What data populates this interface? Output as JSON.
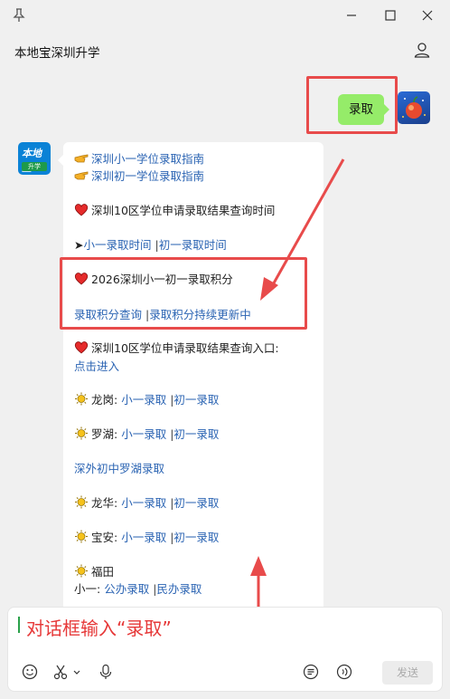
{
  "window": {
    "title": "本地宝深圳升学"
  },
  "outgoing": {
    "text": "录取"
  },
  "incoming": {
    "avatar": {
      "top": "本地宝",
      "bottom": "升学"
    },
    "links_top": [
      "深圳小一学位录取指南",
      "深圳初一学位录取指南"
    ],
    "heading_query_time": "深圳10区学位申请录取结果查询时间",
    "time_prefix": "➤",
    "time_links": [
      "小一录取时间",
      "初一录取时间"
    ],
    "heading_points": "2026深圳小一初一录取积分",
    "points_links": [
      "录取积分查询",
      "录取积分持续更新中"
    ],
    "heading_entry": "深圳10区学位申请录取结果查询入口:",
    "entry_link": "点击进入",
    "districts": [
      {
        "name": "龙岗:",
        "links": [
          "小一录取",
          "初一录取"
        ]
      },
      {
        "name": "罗湖:",
        "links": [
          "小一录取",
          "初一录取"
        ]
      }
    ],
    "special_link": "深外初中罗湖录取",
    "districts2": [
      {
        "name": "龙华:",
        "links": [
          "小一录取",
          "初一录取"
        ]
      },
      {
        "name": "宝安:",
        "links": [
          "小一录取",
          "初一录取"
        ]
      }
    ],
    "futian": {
      "name": "福田",
      "prefix": "小一:",
      "links": [
        "公办录取",
        "民办录取"
      ]
    },
    "separator": "|"
  },
  "input": {
    "hint": "对话框输入“录取”",
    "send_label": "发送"
  },
  "colors": {
    "link": "#2b64b3",
    "annotation": "#e84b4b",
    "bubble_out": "#95ec69"
  }
}
